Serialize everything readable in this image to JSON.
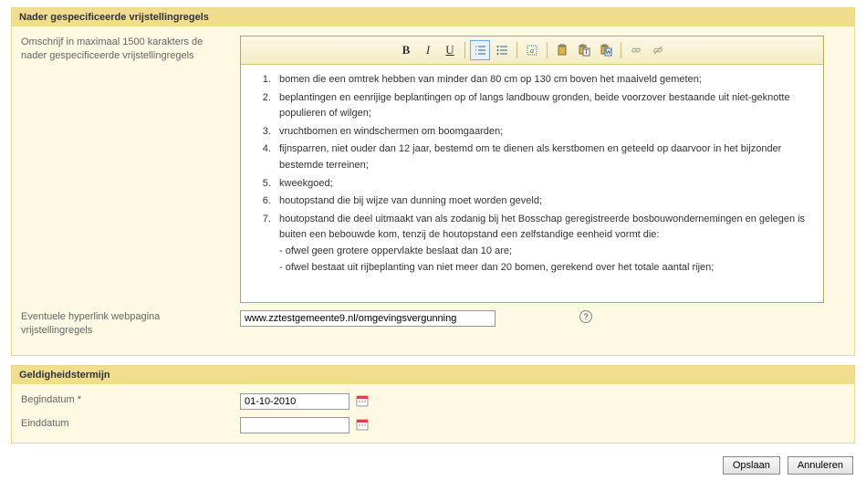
{
  "panel1": {
    "title": "Nader gespecificeerde vrijstellingregels",
    "descLabel": "Omschrijf in maximaal 1500 karakters de nader gespecificeerde vrijstellingregels",
    "hyperlinkLabel": "Eventuele hyperlink webpagina vrijstellingregels",
    "hyperlinkValue": "www.zztestgemeente9.nl/omgevingsvergunning"
  },
  "editorContent": {
    "items": [
      "bomen die een omtrek hebben van minder dan 80 cm op 130 cm boven het maaiveld gemeten;",
      "beplantingen en eenrijige beplantingen op of langs landbouw gronden, beide voorzover bestaande uit niet-geknotte populieren of wilgen;",
      "vruchtbomen en windschermen om boomgaarden;",
      "fijnsparren, niet ouder dan 12 jaar, bestemd om te dienen als kerstbomen en geteeld op daarvoor in het bijzonder bestemde terreinen;",
      "kweekgoed;",
      "houtopstand die bij wijze van dunning moet worden geveld;",
      "houtopstand die deel uitmaakt van als zodanig bij het Bosschap geregistreerde bosbouwondernemingen en gelegen is buiten een bebouwde kom, tenzij de houtopstand een zelfstandige eenheid vormt die:\n- ofwel geen grotere oppervlakte beslaat dan 10 are;\n- ofwel bestaat uit rijbeplanting van niet meer dan 20 bomen, gerekend over het totale aantal rijen;"
    ]
  },
  "toolbar": {
    "bold": "B",
    "italic": "I",
    "underline": "U"
  },
  "panel2": {
    "title": "Geldigheidstermijn",
    "beginLabel": "Begindatum *",
    "beginValue": "01-10-2010",
    "eindLabel": "Einddatum",
    "eindValue": ""
  },
  "buttons": {
    "save": "Opslaan",
    "cancel": "Annuleren"
  }
}
